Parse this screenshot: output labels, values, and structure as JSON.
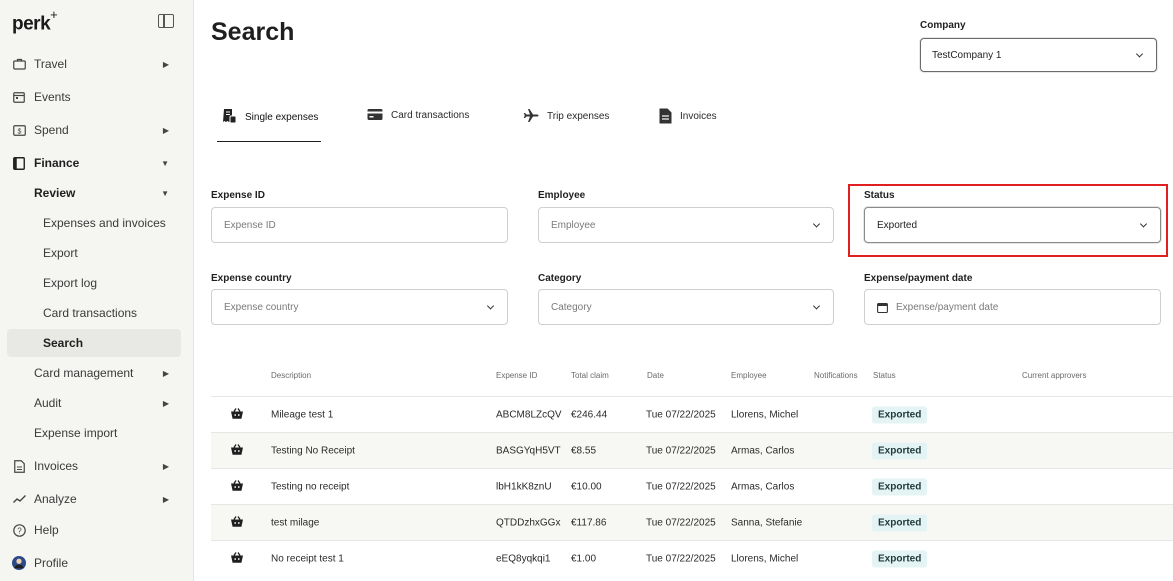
{
  "app": {
    "logo": "perk",
    "logo_sup": "+"
  },
  "sidebar": {
    "items": [
      {
        "label": "Travel"
      },
      {
        "label": "Events"
      },
      {
        "label": "Spend"
      },
      {
        "label": "Finance"
      },
      {
        "label": "Review"
      },
      {
        "label": "Expenses and invoices"
      },
      {
        "label": "Export"
      },
      {
        "label": "Export log"
      },
      {
        "label": "Card transactions"
      },
      {
        "label": "Search"
      },
      {
        "label": "Card management"
      },
      {
        "label": "Audit"
      },
      {
        "label": "Expense import"
      },
      {
        "label": "Invoices"
      },
      {
        "label": "Analyze"
      },
      {
        "label": "Help"
      },
      {
        "label": "Profile"
      }
    ]
  },
  "page": {
    "title": "Search"
  },
  "company": {
    "label": "Company",
    "value": "TestCompany 1"
  },
  "tabs": [
    {
      "label": "Single expenses"
    },
    {
      "label": "Card transactions"
    },
    {
      "label": "Trip expenses"
    },
    {
      "label": "Invoices"
    }
  ],
  "filters": {
    "expense_id": {
      "label": "Expense ID",
      "placeholder": "Expense ID"
    },
    "employee": {
      "label": "Employee",
      "placeholder": "Employee"
    },
    "status": {
      "label": "Status",
      "value": "Exported"
    },
    "expense_country": {
      "label": "Expense country",
      "placeholder": "Expense country"
    },
    "category": {
      "label": "Category",
      "placeholder": "Category"
    },
    "date": {
      "label": "Expense/payment date",
      "placeholder": "Expense/payment date"
    }
  },
  "table": {
    "headers": {
      "description": "Description",
      "expense_id": "Expense ID",
      "total_claim": "Total claim",
      "date": "Date",
      "employee": "Employee",
      "notifications": "Notifications",
      "status": "Status",
      "approvers": "Current approvers"
    },
    "rows": [
      {
        "description": "Mileage test 1",
        "expense_id": "ABCM8LZcQV",
        "total": "€246.44",
        "date": "Tue 07/22/2025",
        "employee": "Llorens, Michel",
        "status": "Exported"
      },
      {
        "description": "Testing No Receipt",
        "expense_id": "BASGYqH5VT",
        "total": "€8.55",
        "date": "Tue 07/22/2025",
        "employee": "Armas, Carlos",
        "status": "Exported"
      },
      {
        "description": "Testing no receipt",
        "expense_id": "lbH1kK8znU",
        "total": "€10.00",
        "date": "Tue 07/22/2025",
        "employee": "Armas, Carlos",
        "status": "Exported"
      },
      {
        "description": "test milage",
        "expense_id": "QTDDzhxGGx",
        "total": "€117.86",
        "date": "Tue 07/22/2025",
        "employee": "Sanna, Stefanie",
        "status": "Exported"
      },
      {
        "description": "No receipt test 1",
        "expense_id": "eEQ8yqkqi1",
        "total": "€1.00",
        "date": "Tue 07/22/2025",
        "employee": "Llorens, Michel",
        "status": "Exported"
      }
    ]
  }
}
